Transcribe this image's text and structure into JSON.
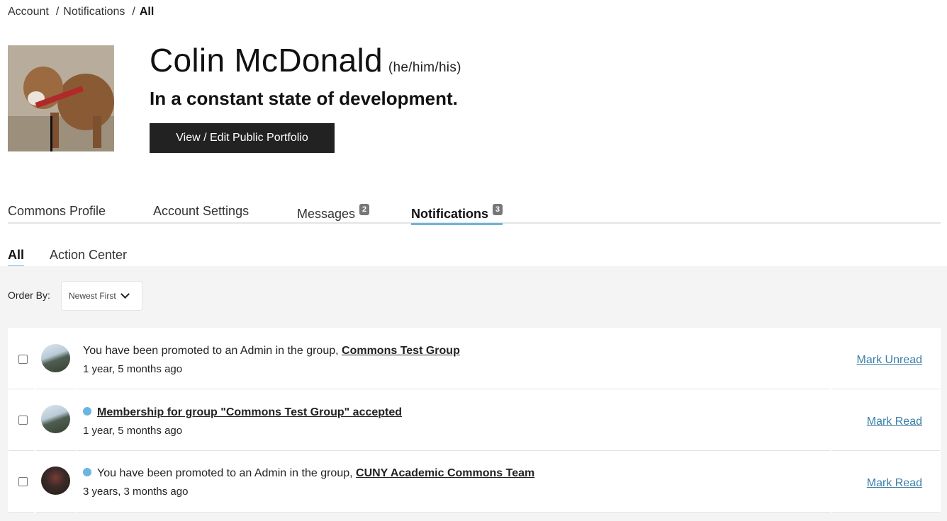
{
  "breadcrumb": {
    "items": [
      "Account",
      "Notifications"
    ],
    "current": "All",
    "separator": "/"
  },
  "profile": {
    "name": "Colin McDonald",
    "pronouns": "(he/him/his)",
    "tagline": "In a constant state of development.",
    "portfolio_button": "View / Edit Public Portfolio"
  },
  "main_tabs": [
    {
      "label": "Commons Profile",
      "badge": null,
      "active": false
    },
    {
      "label": "Account Settings",
      "badge": null,
      "active": false
    },
    {
      "label": "Messages",
      "badge": "2",
      "active": false
    },
    {
      "label": "Notifications",
      "badge": "3",
      "active": true
    }
  ],
  "sub_tabs": [
    {
      "label": "All",
      "active": true
    },
    {
      "label": "Action Center",
      "active": false
    }
  ],
  "order": {
    "label": "Order By:",
    "selected": "Newest First"
  },
  "colors": {
    "accent": "#6bb5e1",
    "link": "#3b7fa8",
    "button_bg": "#222222",
    "panel_bg": "#f4f4f4"
  },
  "notifications": [
    {
      "unread": false,
      "avatar": "mountain",
      "text": "You have been promoted to an Admin in the group, ",
      "link": "Commons Test Group",
      "time": "1 year, 5 months ago",
      "action": "Mark Unread"
    },
    {
      "unread": true,
      "avatar": "mountain",
      "text": "",
      "link": "Membership for group \"Commons Test Group\" accepted",
      "time": "1 year, 5 months ago",
      "action": "Mark Read"
    },
    {
      "unread": true,
      "avatar": "people",
      "text": "You have been promoted to an Admin in the group, ",
      "link": "CUNY Academic Commons Team",
      "time": "3 years, 3 months ago",
      "action": "Mark Read"
    }
  ]
}
